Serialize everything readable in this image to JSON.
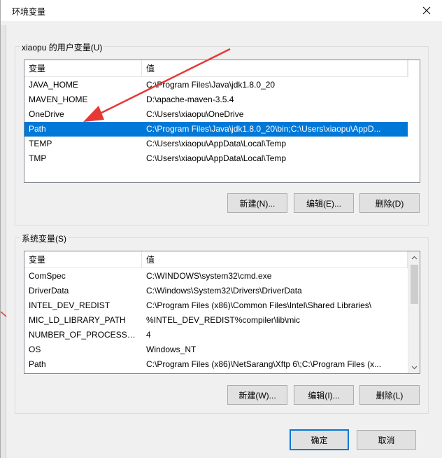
{
  "window": {
    "title": "环境变量"
  },
  "user_group": {
    "label": "xiaopu 的用户变量(U)",
    "headers": [
      "变量",
      "值"
    ],
    "rows": [
      {
        "name": "JAVA_HOME",
        "value": "C:\\Program Files\\Java\\jdk1.8.0_20"
      },
      {
        "name": "MAVEN_HOME",
        "value": "D:\\apache-maven-3.5.4"
      },
      {
        "name": "OneDrive",
        "value": "C:\\Users\\xiaopu\\OneDrive"
      },
      {
        "name": "Path",
        "value": "C:\\Program Files\\Java\\jdk1.8.0_20\\bin;C:\\Users\\xiaopu\\AppD..."
      },
      {
        "name": "TEMP",
        "value": "C:\\Users\\xiaopu\\AppData\\Local\\Temp"
      },
      {
        "name": "TMP",
        "value": "C:\\Users\\xiaopu\\AppData\\Local\\Temp"
      }
    ],
    "selected_row": 3,
    "buttons": {
      "new": "新建(N)...",
      "edit": "编辑(E)...",
      "delete": "删除(D)"
    }
  },
  "system_group": {
    "label": "系统变量(S)",
    "headers": [
      "变量",
      "值"
    ],
    "rows": [
      {
        "name": "ComSpec",
        "value": "C:\\WINDOWS\\system32\\cmd.exe"
      },
      {
        "name": "DriverData",
        "value": "C:\\Windows\\System32\\Drivers\\DriverData"
      },
      {
        "name": "INTEL_DEV_REDIST",
        "value": "C:\\Program Files (x86)\\Common Files\\Intel\\Shared Libraries\\"
      },
      {
        "name": "MIC_LD_LIBRARY_PATH",
        "value": "%INTEL_DEV_REDIST%compiler\\lib\\mic"
      },
      {
        "name": "NUMBER_OF_PROCESSORS",
        "value": "4"
      },
      {
        "name": "OS",
        "value": "Windows_NT"
      },
      {
        "name": "Path",
        "value": "C:\\Program Files (x86)\\NetSarang\\Xftp 6\\;C:\\Program Files (x..."
      }
    ],
    "buttons": {
      "new": "新建(W)...",
      "edit": "编辑(I)...",
      "delete": "删除(L)"
    }
  },
  "footer": {
    "ok": "确定",
    "cancel": "取消"
  },
  "colors": {
    "selection": "#0078d7",
    "annotation_arrow": "#e53935"
  }
}
